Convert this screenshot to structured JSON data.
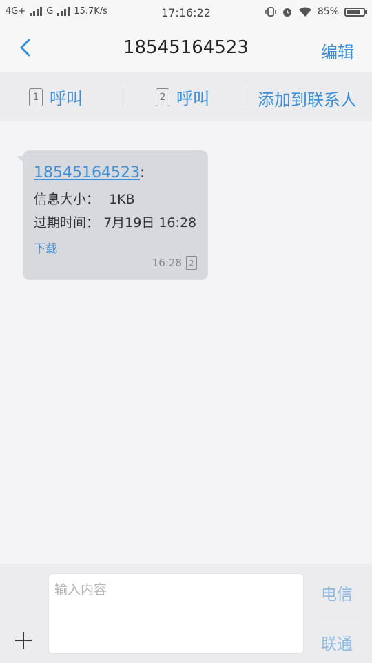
{
  "status_bar": {
    "network_left": "4G+",
    "network_right": "G",
    "speed": "15.7K/s",
    "time": "17:16:22",
    "battery": "85%",
    "battery_level": 0.85
  },
  "header": {
    "title": "18545164523",
    "edit_label": "编辑"
  },
  "actions": {
    "call1_sim": "1",
    "call1_label": "呼叫",
    "call2_sim": "2",
    "call2_label": "呼叫",
    "add_contact_label": "添加到联系人"
  },
  "message": {
    "sender": "18545164523",
    "colon": ":",
    "size_label": "信息大小：",
    "size_value": "1KB",
    "expiry_label": "过期时间：",
    "expiry_value": "7月19日 16:28",
    "download_label": "下载",
    "time": "16:28",
    "sim": "2"
  },
  "composer": {
    "placeholder": "输入内容",
    "send_telecom": "电信",
    "send_unicom": "联通"
  },
  "colors": {
    "accent": "#3b8fd8",
    "bubble": "#d7d9de",
    "background": "#f4f4f6"
  }
}
